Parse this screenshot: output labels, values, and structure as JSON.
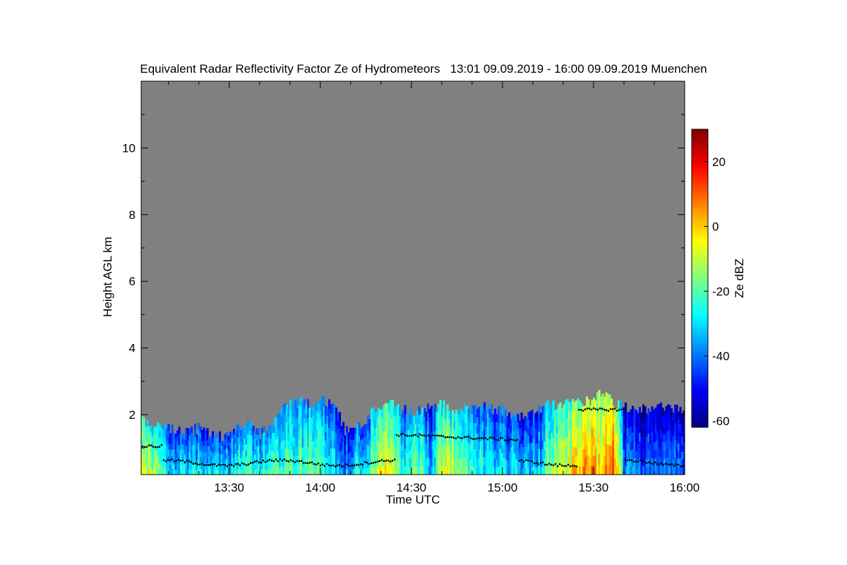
{
  "chart_data": {
    "type": "heatmap",
    "title": "Equivalent Radar Reflectivity Factor Ze of Hydrometeors   13:01 09.09.2019 - 16:00 09.09.2019 Muenchen",
    "xlabel": "Time UTC",
    "ylabel": "Height AGL km",
    "x_ticks": [
      "13:30",
      "14:00",
      "14:30",
      "15:00",
      "15:30",
      "16:00"
    ],
    "x_tick_minutes": [
      30,
      60,
      90,
      120,
      150,
      180
    ],
    "xlim_minutes": [
      1,
      180
    ],
    "y_ticks": [
      2,
      4,
      6,
      8,
      10
    ],
    "ylim": [
      0.2,
      12.0
    ],
    "colorbar": {
      "label": "Ze dBZ",
      "ticks": [
        20,
        0,
        -20,
        -40,
        -60
      ],
      "range": [
        -62,
        30
      ],
      "colors": [
        "#00007f",
        "#0000ff",
        "#007fff",
        "#00ffff",
        "#7fff7f",
        "#ffff00",
        "#ff7f00",
        "#ff0000",
        "#7f0000"
      ]
    },
    "background_color": "#808080",
    "cloud_top_profile": {
      "time_minutes": [
        1,
        4,
        8,
        12,
        16,
        20,
        24,
        28,
        32,
        36,
        40,
        44,
        48,
        52,
        56,
        60,
        64,
        68,
        72,
        76,
        80,
        84,
        88,
        92,
        96,
        100,
        104,
        108,
        112,
        116,
        120,
        124,
        128,
        132,
        136,
        140,
        144,
        148,
        152,
        156,
        160,
        164,
        168,
        172,
        176,
        180
      ],
      "top_km": [
        1.9,
        1.6,
        1.7,
        1.5,
        1.5,
        1.6,
        1.4,
        1.3,
        1.6,
        1.7,
        1.4,
        1.8,
        2.2,
        2.4,
        2.3,
        2.4,
        2.4,
        1.5,
        1.6,
        2.0,
        2.2,
        2.3,
        2.1,
        2.1,
        2.2,
        2.3,
        2.1,
        2.2,
        2.2,
        2.2,
        2.1,
        2.0,
        1.9,
        2.2,
        2.3,
        2.3,
        2.4,
        2.4,
        2.6,
        2.4,
        2.2,
        2.1,
        2.2,
        2.2,
        2.2,
        2.0
      ],
      "mean_dbz": [
        -5,
        -10,
        -25,
        -30,
        -30,
        -28,
        -28,
        -30,
        -25,
        -22,
        -25,
        -22,
        -20,
        -22,
        -18,
        -20,
        -28,
        -35,
        -25,
        -22,
        -5,
        -10,
        -25,
        -15,
        -35,
        -8,
        -10,
        -20,
        -25,
        -30,
        -30,
        -30,
        -35,
        -30,
        -10,
        -12,
        0,
        5,
        -2,
        15,
        -40,
        -40,
        -40,
        -40,
        -40,
        -40
      ]
    }
  }
}
